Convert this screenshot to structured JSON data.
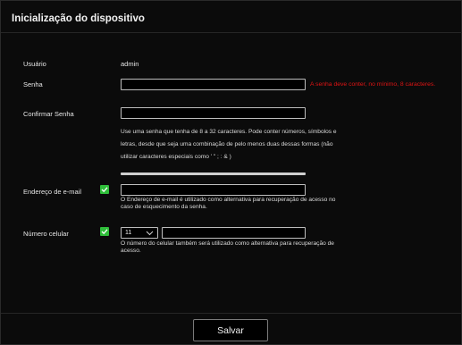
{
  "header": {
    "title": "Inicialização do dispositivo"
  },
  "form": {
    "user_label": "Usuário",
    "user_value": "admin",
    "password_label": "Senha",
    "password_value": "",
    "password_error": "A senha deve conter, no mínimo, 8 caracteres.",
    "confirm_label": "Confirmar Senha",
    "confirm_value": "",
    "password_hint_lines": [
      "Use uma senha que tenha de 8 a 32 caracteres. Pode conter números, símbolos e",
      "letras, desde que seja uma combinação de pelo menos duas dessas formas (não",
      "utilizar caracteres especiais como ' \" ; : & )"
    ],
    "email_label": "Endereço de e-mail",
    "email_checked": true,
    "email_value": "",
    "email_hint_lines": [
      "O Endereço de e-mail é utilizado como alternativa para recuperação de acesso no",
      "caso de esquecimento da senha."
    ],
    "phone_label": "Número celular",
    "phone_checked": true,
    "phone_country_code": "11",
    "phone_value": "",
    "phone_hint_lines": [
      "O número do celular também será utilizado como alternativa para recuperação de",
      "acesso."
    ]
  },
  "footer": {
    "save_label": "Salvar"
  },
  "colors": {
    "accent_green": "#2fbe3a",
    "error_red": "#e01414"
  },
  "icons": {
    "checkbox": "checkmark-icon",
    "select": "chevron-down-icon"
  }
}
